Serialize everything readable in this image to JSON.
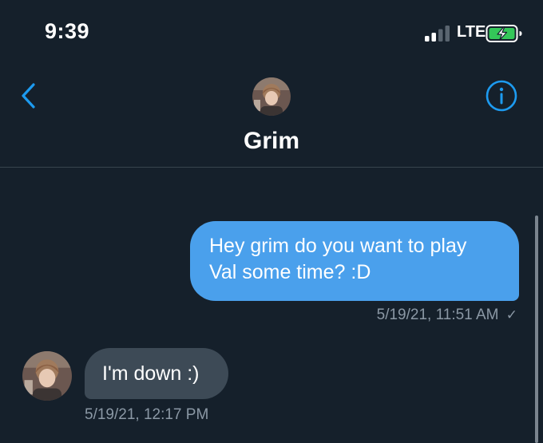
{
  "status_bar": {
    "time": "9:39",
    "network": "LTE",
    "signal_bars_filled": 2,
    "signal_bars_total": 4,
    "battery_charging": true
  },
  "header": {
    "contact_name": "Grim"
  },
  "messages": [
    {
      "direction": "sent",
      "text": "Hey grim do you want to play Val some time? :D",
      "timestamp": "5/19/21, 11:51 AM",
      "status_icon": "checkmark-icon"
    },
    {
      "direction": "received",
      "text": "I'm down :)",
      "timestamp": "5/19/21, 12:17 PM"
    }
  ],
  "colors": {
    "background": "#15202b",
    "sent_bubble": "#4aa0ec",
    "received_bubble": "#3d4a56",
    "accent": "#1d9bf0",
    "muted_text": "#8b98a5"
  }
}
